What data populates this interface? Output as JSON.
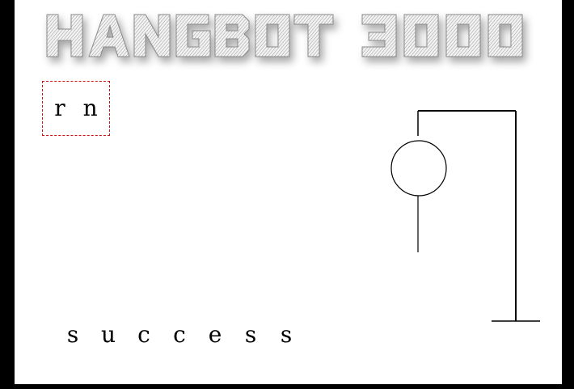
{
  "app": {
    "logo_text": "HANGBOT 3000",
    "logo_color": "#d8d8d8",
    "frame_color": "#000000",
    "wrong_box_border_color": "#d01010"
  },
  "wrong_guesses": [
    "r",
    "n"
  ],
  "word": {
    "letters": [
      "s",
      "u",
      "c",
      "c",
      "e",
      "s",
      "s"
    ]
  },
  "hangman": {
    "parts_shown": [
      "head",
      "body"
    ]
  }
}
